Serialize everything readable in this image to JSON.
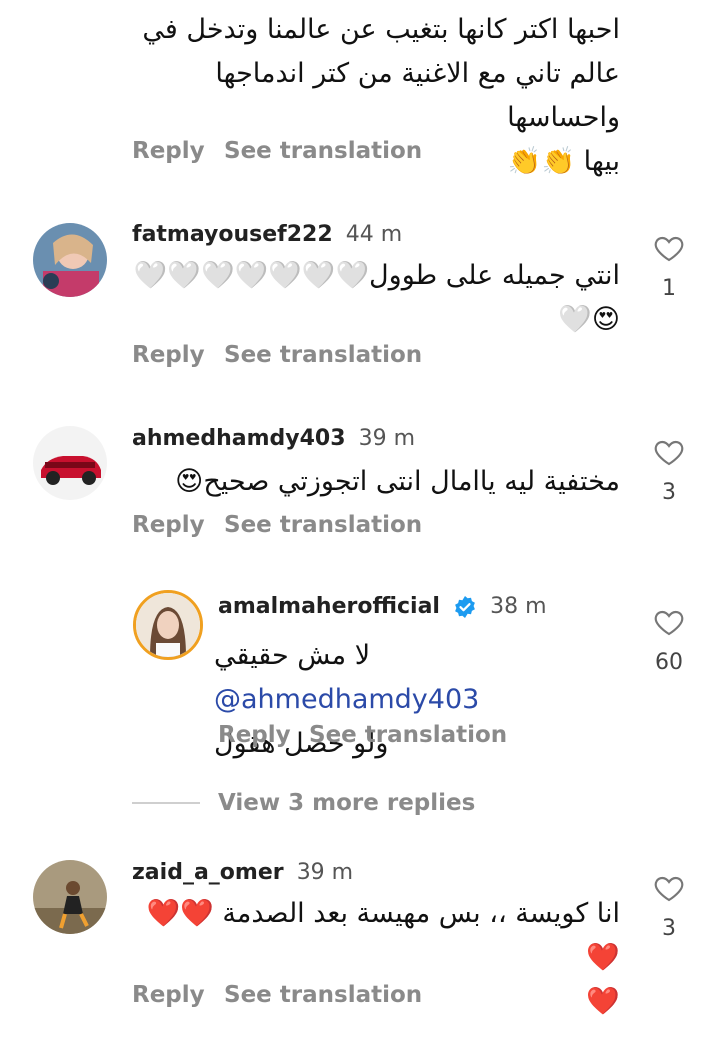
{
  "comments": [
    {
      "text_lines": [
        "احبها اكتر كانها بتغيب عن عالمنا وتدخل في",
        "عالم تاني مع الاغنية من كتر اندماجها واحساسها",
        "بيها 👏👏"
      ],
      "reply_label": "Reply",
      "translate_label": "See translation"
    },
    {
      "username": "fatmayousef222",
      "time": "44 m",
      "text_lines": [
        "انتي جميله على طوول🤍🤍🤍🤍🤍🤍🤍",
        "😍🤍"
      ],
      "likes": "1",
      "reply_label": "Reply",
      "translate_label": "See translation"
    },
    {
      "username": "ahmedhamdy403",
      "time": "39 m",
      "text_lines": [
        "مختفية ليه ياامال انتى اتجوزتي صحيح😍"
      ],
      "likes": "3",
      "reply_label": "Reply",
      "translate_label": "See translation"
    },
    {
      "username": "amalmaherofficial",
      "time": "38 m",
      "verified": true,
      "mention": "@ahmedhamdy403",
      "text_line1": "لا مش حقيقي",
      "text_line2": "ولو حصل هقول",
      "likes": "60",
      "reply_label": "Reply",
      "translate_label": "See translation"
    },
    {
      "username": "zaid_a_omer",
      "time": "39 m",
      "text_lines": [
        "انا كويسة ،، بس مهيسة بعد الصدمة ❤️❤️❤️",
        "❤️"
      ],
      "likes": "3",
      "reply_label": "Reply",
      "translate_label": "See translation"
    }
  ],
  "view_more_replies": "View 3 more replies",
  "colors": {
    "link": "#2b4aa8",
    "muted": "#8a8a8a",
    "verified": "#1d9bf0"
  }
}
